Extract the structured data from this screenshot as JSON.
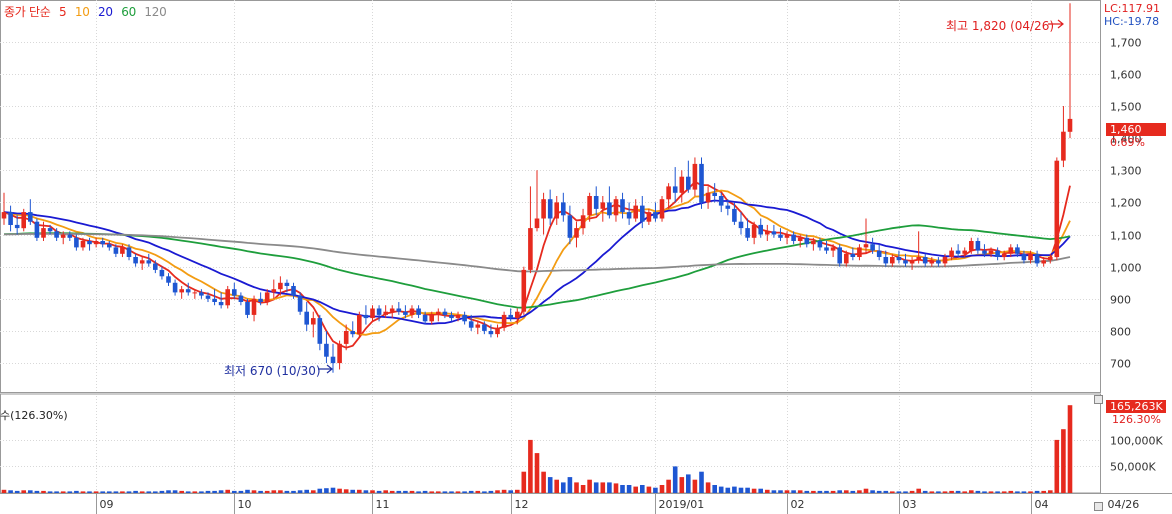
{
  "legend": {
    "title": "종가 단순",
    "ma": [
      {
        "label": "5",
        "color": "#e62a1e"
      },
      {
        "label": "10",
        "color": "#f39c12"
      },
      {
        "label": "20",
        "color": "#1a1ad2"
      },
      {
        "label": "60",
        "color": "#1e9e3c"
      },
      {
        "label": "120",
        "color": "#8a8a8a"
      }
    ]
  },
  "readouts": {
    "lc": "LC:117.91",
    "hc": "HC:-19.78"
  },
  "annotations": {
    "high": "최고 1,820 (04/26)",
    "low": "최저 670 (10/30)"
  },
  "current": {
    "price": "1,460",
    "price_pct": "0.69%",
    "volume": "165,263K",
    "volume_pct": "126.30%"
  },
  "volume_title": "수(126.30%)",
  "colors": {
    "up": "#e62a1e",
    "down": "#1e56d2",
    "grid": "#d8d8d8"
  },
  "chart_data": {
    "type": "candlestick",
    "price_axis": {
      "ticks": [
        "700",
        "800",
        "900",
        "1,000",
        "1,100",
        "1,200",
        "1,300",
        "1,400",
        "1,500",
        "1,600",
        "1,700"
      ],
      "tick_values": [
        700,
        800,
        900,
        1000,
        1100,
        1200,
        1300,
        1400,
        1500,
        1600,
        1700
      ],
      "range": [
        610,
        1830
      ]
    },
    "volume_axis": {
      "ticks": [
        "50,000K",
        "100,000K"
      ],
      "tick_values": [
        50000,
        100000
      ],
      "max": 175000
    },
    "x_labels": [
      "09",
      "10",
      "11",
      "12",
      "2019/01",
      "02",
      "03",
      "04",
      "04/26"
    ],
    "x_label_index": [
      14,
      35,
      56,
      77,
      99,
      119,
      136,
      156,
      180
    ],
    "ohlc_key": "[open, high, low, close, volume_k]",
    "candles": [
      [
        1150,
        1230,
        1130,
        1170,
        6000
      ],
      [
        1170,
        1190,
        1110,
        1130,
        5000
      ],
      [
        1130,
        1160,
        1100,
        1120,
        4000
      ],
      [
        1120,
        1180,
        1110,
        1170,
        5000
      ],
      [
        1170,
        1210,
        1130,
        1140,
        5000
      ],
      [
        1140,
        1150,
        1080,
        1090,
        4000
      ],
      [
        1090,
        1140,
        1080,
        1120,
        4000
      ],
      [
        1120,
        1130,
        1100,
        1110,
        3000
      ],
      [
        1110,
        1120,
        1080,
        1090,
        3000
      ],
      [
        1090,
        1110,
        1070,
        1100,
        3000
      ],
      [
        1100,
        1110,
        1080,
        1090,
        3000
      ],
      [
        1090,
        1100,
        1050,
        1060,
        4000
      ],
      [
        1060,
        1090,
        1050,
        1080,
        3000
      ],
      [
        1080,
        1090,
        1050,
        1070,
        3000
      ],
      [
        1070,
        1090,
        1060,
        1080,
        3000
      ],
      [
        1080,
        1090,
        1060,
        1070,
        3000
      ],
      [
        1070,
        1080,
        1050,
        1060,
        3000
      ],
      [
        1060,
        1070,
        1030,
        1040,
        3000
      ],
      [
        1040,
        1070,
        1030,
        1060,
        3000
      ],
      [
        1060,
        1070,
        1020,
        1030,
        3000
      ],
      [
        1030,
        1040,
        1000,
        1010,
        4000
      ],
      [
        1010,
        1030,
        990,
        1020,
        3000
      ],
      [
        1020,
        1040,
        1000,
        1010,
        3000
      ],
      [
        1010,
        1020,
        980,
        990,
        3000
      ],
      [
        990,
        1000,
        960,
        970,
        4000
      ],
      [
        970,
        980,
        940,
        950,
        5000
      ],
      [
        950,
        960,
        910,
        920,
        5000
      ],
      [
        920,
        940,
        900,
        930,
        4000
      ],
      [
        930,
        950,
        910,
        920,
        3000
      ],
      [
        920,
        930,
        900,
        920,
        3000
      ],
      [
        920,
        930,
        900,
        910,
        3000
      ],
      [
        910,
        920,
        890,
        900,
        4000
      ],
      [
        900,
        930,
        880,
        890,
        4000
      ],
      [
        890,
        920,
        870,
        880,
        5000
      ],
      [
        880,
        940,
        870,
        930,
        6000
      ],
      [
        930,
        950,
        900,
        910,
        4000
      ],
      [
        910,
        920,
        880,
        890,
        4000
      ],
      [
        890,
        900,
        840,
        850,
        6000
      ],
      [
        850,
        910,
        830,
        900,
        5000
      ],
      [
        900,
        920,
        880,
        890,
        4000
      ],
      [
        890,
        930,
        880,
        920,
        4000
      ],
      [
        920,
        960,
        900,
        930,
        5000
      ],
      [
        930,
        970,
        910,
        950,
        5000
      ],
      [
        950,
        960,
        920,
        940,
        4000
      ],
      [
        940,
        950,
        900,
        910,
        4000
      ],
      [
        910,
        920,
        850,
        860,
        5000
      ],
      [
        860,
        890,
        800,
        820,
        6000
      ],
      [
        820,
        860,
        780,
        840,
        5000
      ],
      [
        840,
        850,
        740,
        760,
        8000
      ],
      [
        760,
        800,
        700,
        720,
        9000
      ],
      [
        720,
        760,
        670,
        700,
        10000
      ],
      [
        700,
        770,
        680,
        760,
        8000
      ],
      [
        760,
        820,
        740,
        800,
        7000
      ],
      [
        800,
        830,
        780,
        790,
        6000
      ],
      [
        790,
        860,
        780,
        850,
        6000
      ],
      [
        850,
        880,
        820,
        840,
        5000
      ],
      [
        840,
        880,
        830,
        870,
        5000
      ],
      [
        870,
        880,
        830,
        850,
        4000
      ],
      [
        850,
        880,
        840,
        860,
        5000
      ],
      [
        860,
        880,
        840,
        870,
        4000
      ],
      [
        870,
        890,
        850,
        860,
        4000
      ],
      [
        860,
        880,
        840,
        850,
        4000
      ],
      [
        850,
        880,
        840,
        870,
        4000
      ],
      [
        870,
        880,
        840,
        850,
        3000
      ],
      [
        850,
        860,
        820,
        830,
        4000
      ],
      [
        830,
        860,
        820,
        850,
        3000
      ],
      [
        850,
        870,
        830,
        860,
        3000
      ],
      [
        860,
        870,
        840,
        850,
        3000
      ],
      [
        850,
        860,
        830,
        840,
        3000
      ],
      [
        840,
        860,
        830,
        850,
        3000
      ],
      [
        850,
        860,
        820,
        830,
        3000
      ],
      [
        830,
        850,
        800,
        810,
        4000
      ],
      [
        810,
        830,
        790,
        820,
        4000
      ],
      [
        820,
        830,
        790,
        800,
        3000
      ],
      [
        800,
        820,
        780,
        790,
        4000
      ],
      [
        790,
        820,
        780,
        810,
        5000
      ],
      [
        810,
        860,
        800,
        850,
        6000
      ],
      [
        850,
        870,
        830,
        840,
        5000
      ],
      [
        840,
        870,
        820,
        860,
        6000
      ],
      [
        860,
        1000,
        850,
        990,
        40000
      ],
      [
        990,
        1250,
        980,
        1120,
        100000
      ],
      [
        1120,
        1300,
        1110,
        1150,
        75000
      ],
      [
        1150,
        1230,
        1100,
        1210,
        40000
      ],
      [
        1210,
        1240,
        1130,
        1150,
        30000
      ],
      [
        1150,
        1220,
        1130,
        1200,
        25000
      ],
      [
        1200,
        1230,
        1140,
        1160,
        20000
      ],
      [
        1160,
        1190,
        1070,
        1090,
        30000
      ],
      [
        1090,
        1140,
        1060,
        1120,
        20000
      ],
      [
        1120,
        1180,
        1100,
        1160,
        15000
      ],
      [
        1160,
        1230,
        1140,
        1220,
        25000
      ],
      [
        1220,
        1250,
        1160,
        1180,
        20000
      ],
      [
        1180,
        1220,
        1140,
        1200,
        20000
      ],
      [
        1200,
        1250,
        1150,
        1160,
        20000
      ],
      [
        1160,
        1220,
        1140,
        1210,
        18000
      ],
      [
        1210,
        1230,
        1150,
        1170,
        15000
      ],
      [
        1170,
        1200,
        1130,
        1150,
        15000
      ],
      [
        1150,
        1210,
        1140,
        1190,
        12000
      ],
      [
        1190,
        1220,
        1120,
        1140,
        15000
      ],
      [
        1140,
        1180,
        1130,
        1170,
        12000
      ],
      [
        1170,
        1200,
        1140,
        1150,
        10000
      ],
      [
        1150,
        1220,
        1140,
        1210,
        15000
      ],
      [
        1210,
        1260,
        1180,
        1250,
        25000
      ],
      [
        1250,
        1310,
        1200,
        1230,
        50000
      ],
      [
        1230,
        1300,
        1200,
        1280,
        30000
      ],
      [
        1280,
        1330,
        1230,
        1240,
        35000
      ],
      [
        1240,
        1340,
        1220,
        1320,
        25000
      ],
      [
        1320,
        1340,
        1180,
        1200,
        40000
      ],
      [
        1200,
        1250,
        1180,
        1230,
        20000
      ],
      [
        1230,
        1260,
        1200,
        1220,
        15000
      ],
      [
        1220,
        1230,
        1170,
        1190,
        12000
      ],
      [
        1190,
        1210,
        1160,
        1180,
        10000
      ],
      [
        1180,
        1200,
        1130,
        1140,
        12000
      ],
      [
        1140,
        1170,
        1100,
        1120,
        10000
      ],
      [
        1120,
        1150,
        1080,
        1090,
        10000
      ],
      [
        1090,
        1140,
        1070,
        1130,
        8000
      ],
      [
        1130,
        1150,
        1090,
        1100,
        8000
      ],
      [
        1100,
        1130,
        1080,
        1110,
        6000
      ],
      [
        1110,
        1130,
        1090,
        1100,
        5000
      ],
      [
        1100,
        1120,
        1080,
        1090,
        5000
      ],
      [
        1090,
        1110,
        1070,
        1100,
        5000
      ],
      [
        1100,
        1110,
        1070,
        1080,
        5000
      ],
      [
        1080,
        1100,
        1060,
        1090,
        5000
      ],
      [
        1090,
        1100,
        1060,
        1070,
        4000
      ],
      [
        1070,
        1090,
        1050,
        1080,
        4000
      ],
      [
        1080,
        1090,
        1050,
        1060,
        4000
      ],
      [
        1060,
        1080,
        1040,
        1050,
        4000
      ],
      [
        1050,
        1070,
        1030,
        1060,
        4000
      ],
      [
        1060,
        1070,
        1000,
        1010,
        5000
      ],
      [
        1010,
        1050,
        1000,
        1040,
        5000
      ],
      [
        1040,
        1060,
        1020,
        1030,
        4000
      ],
      [
        1030,
        1070,
        1020,
        1060,
        5000
      ],
      [
        1060,
        1150,
        1040,
        1070,
        8000
      ],
      [
        1070,
        1090,
        1040,
        1050,
        5000
      ],
      [
        1050,
        1070,
        1020,
        1030,
        4000
      ],
      [
        1030,
        1050,
        1000,
        1010,
        4000
      ],
      [
        1010,
        1040,
        1000,
        1030,
        3000
      ],
      [
        1030,
        1050,
        1010,
        1020,
        3000
      ],
      [
        1020,
        1040,
        1000,
        1010,
        3000
      ],
      [
        1010,
        1030,
        990,
        1020,
        4000
      ],
      [
        1020,
        1110,
        1010,
        1030,
        8000
      ],
      [
        1030,
        1040,
        1000,
        1010,
        4000
      ],
      [
        1010,
        1030,
        1000,
        1020,
        3000
      ],
      [
        1020,
        1030,
        1000,
        1010,
        3000
      ],
      [
        1010,
        1040,
        1000,
        1030,
        3000
      ],
      [
        1030,
        1060,
        1020,
        1050,
        4000
      ],
      [
        1050,
        1070,
        1030,
        1040,
        4000
      ],
      [
        1040,
        1060,
        1030,
        1050,
        3000
      ],
      [
        1050,
        1090,
        1040,
        1080,
        5000
      ],
      [
        1080,
        1090,
        1040,
        1050,
        4000
      ],
      [
        1050,
        1070,
        1030,
        1040,
        3000
      ],
      [
        1040,
        1060,
        1030,
        1050,
        3000
      ],
      [
        1050,
        1060,
        1020,
        1030,
        3000
      ],
      [
        1030,
        1050,
        1020,
        1040,
        3000
      ],
      [
        1040,
        1070,
        1030,
        1060,
        4000
      ],
      [
        1060,
        1070,
        1030,
        1040,
        3000
      ],
      [
        1040,
        1050,
        1010,
        1020,
        3000
      ],
      [
        1020,
        1050,
        1010,
        1040,
        3000
      ],
      [
        1040,
        1050,
        1000,
        1010,
        4000
      ],
      [
        1010,
        1030,
        1000,
        1020,
        4000
      ],
      [
        1020,
        1040,
        1010,
        1030,
        5000
      ],
      [
        1030,
        1340,
        1020,
        1330,
        100000
      ],
      [
        1330,
        1500,
        1310,
        1420,
        120000
      ],
      [
        1420,
        1820,
        1400,
        1460,
        165263
      ]
    ]
  }
}
